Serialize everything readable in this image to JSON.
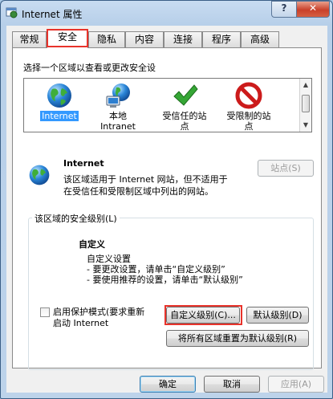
{
  "window": {
    "title": "Internet 属性",
    "help_label": "?",
    "close_label": "✕"
  },
  "tabs": [
    {
      "label": "常规"
    },
    {
      "label": "安全",
      "active": true
    },
    {
      "label": "隐私"
    },
    {
      "label": "内容"
    },
    {
      "label": "连接"
    },
    {
      "label": "程序"
    },
    {
      "label": "高级"
    }
  ],
  "security": {
    "zone_prompt": "选择一个区域以查看或更改安全设",
    "zones": [
      {
        "label": "Internet",
        "icon": "globe-icon",
        "selected": true
      },
      {
        "label": "本地\nIntranet",
        "icon": "intranet-icon"
      },
      {
        "label": "受信任的站\n点",
        "icon": "checkmark-icon"
      },
      {
        "label": "受限制的站\n点",
        "icon": "no-entry-icon"
      }
    ],
    "zone_title": "Internet",
    "zone_desc_line1": "该区域适用于 Internet 网站，但不适用于",
    "zone_desc_line2": "在受信任和受限制区域中列出的网站。",
    "sites_button": "站点(S)",
    "level_group_label": "该区域的安全级别(L)",
    "level_name": "自定义",
    "level_line1": "自定义设置",
    "level_line2": "- 要更改设置，请单击“自定义级别”",
    "level_line3": "- 要使用推荐的设置，请单击“默认级别”",
    "protected_mode_line1": "启用保护模式(要求重新",
    "protected_mode_line2": "启动 Internet",
    "custom_level_button": "自定义级别(C)...",
    "default_level_button": "默认级别(D)",
    "reset_all_button": "将所有区域重置为默认级别(R)"
  },
  "footer": {
    "ok_button": "确定",
    "cancel_button": "取消",
    "apply_button": "应用(A)"
  }
}
